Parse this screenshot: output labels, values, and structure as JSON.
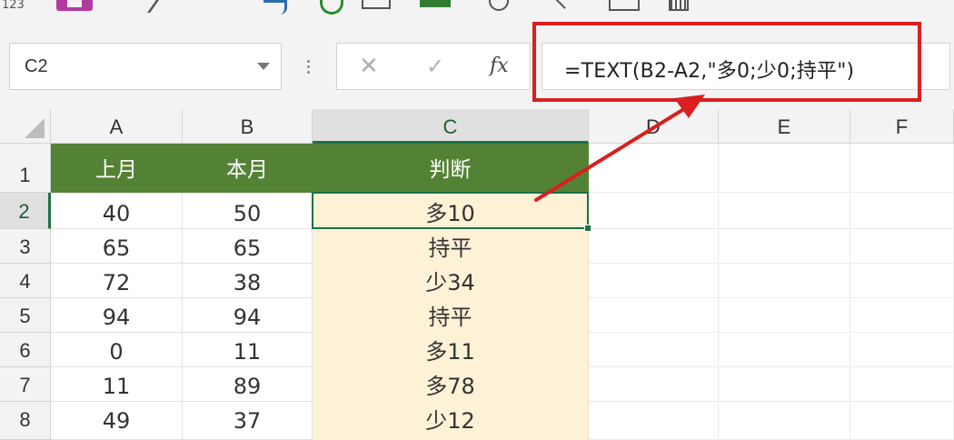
{
  "toolbar": {
    "partial_label": "123"
  },
  "formula_bar": {
    "name_box": "C2",
    "formula": "=TEXT(B2-A2,\"多0;少0;持平\")",
    "cancel_symbol": "✕",
    "confirm_symbol": "✓",
    "function_symbol": "fx"
  },
  "columns": [
    "A",
    "B",
    "C",
    "D",
    "E",
    "F"
  ],
  "rows": [
    "1",
    "2",
    "3",
    "4",
    "5",
    "6",
    "7",
    "8"
  ],
  "table": {
    "headers": [
      "上月",
      "本月",
      "判断"
    ],
    "data": [
      [
        "40",
        "50",
        "多10"
      ],
      [
        "65",
        "65",
        "持平"
      ],
      [
        "72",
        "38",
        "少34"
      ],
      [
        "94",
        "94",
        "持平"
      ],
      [
        "0",
        "11",
        "多11"
      ],
      [
        "11",
        "89",
        "多78"
      ],
      [
        "49",
        "37",
        "少12"
      ]
    ]
  },
  "colors": {
    "header_fill": "#548235",
    "result_fill": "#fdf1d6",
    "annotation_red": "#d91f1f",
    "selection_green": "#1e7145"
  }
}
